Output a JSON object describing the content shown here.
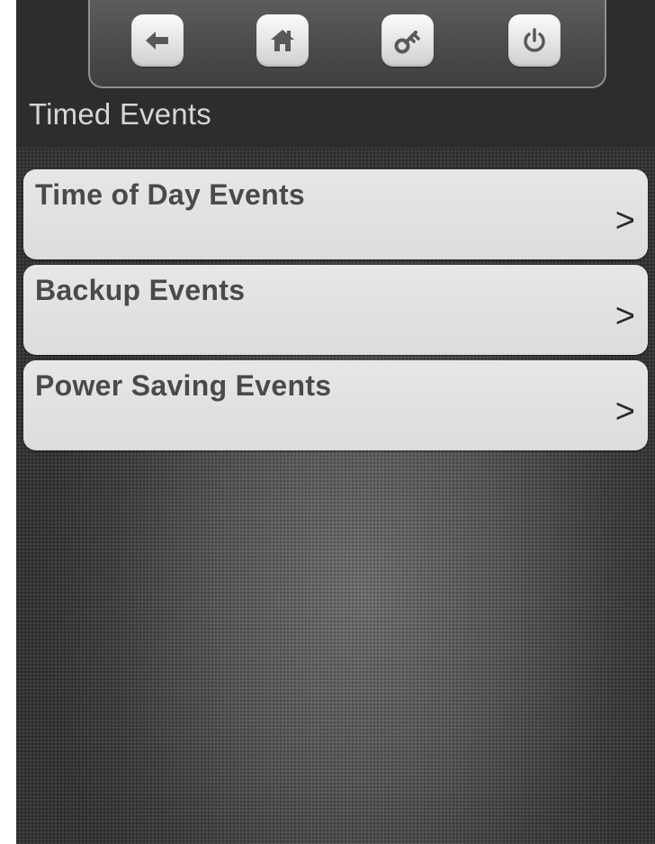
{
  "header": {
    "title": "Timed Events",
    "nav_buttons": [
      {
        "name": "back",
        "icon": "arrow-left-icon"
      },
      {
        "name": "home",
        "icon": "home-icon"
      },
      {
        "name": "key",
        "icon": "key-icon"
      },
      {
        "name": "power",
        "icon": "power-icon"
      }
    ]
  },
  "menu": {
    "items": [
      {
        "label": "Time of Day Events",
        "arrow": ">"
      },
      {
        "label": "Backup Events",
        "arrow": ">"
      },
      {
        "label": "Power Saving Events",
        "arrow": ">"
      }
    ]
  },
  "colors": {
    "header_bg": "#2d2d2d",
    "menu_item_bg": "#e3e3e3",
    "menu_text": "#4a4a4a",
    "title_text": "#d6d6d6",
    "icon_color": "#595959"
  }
}
